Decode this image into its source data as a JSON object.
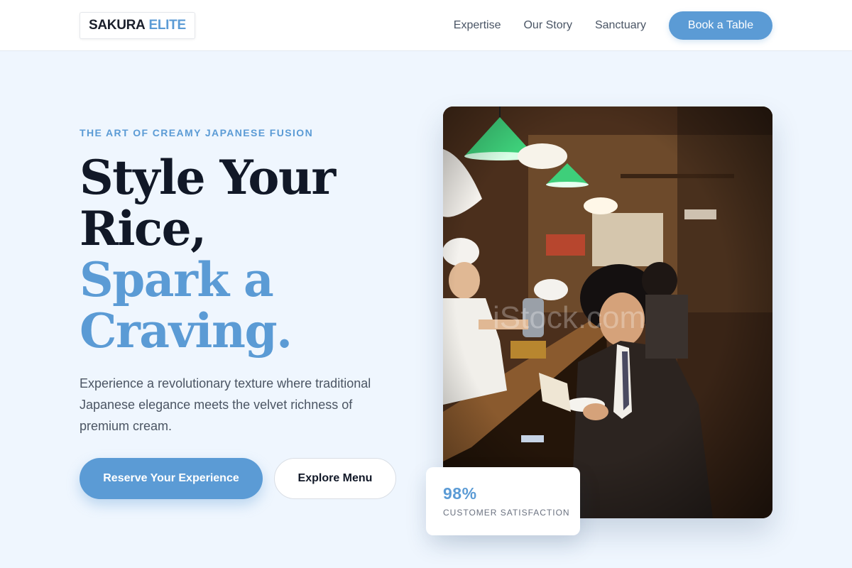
{
  "header": {
    "brand_part1": "SAKURA",
    "brand_part2": "ELITE",
    "nav": [
      "Expertise",
      "Our Story",
      "Sanctuary"
    ],
    "cta": "Book a Table"
  },
  "hero": {
    "eyebrow": "THE ART OF CREAMY JAPANESE FUSION",
    "title_line1": "Style Your",
    "title_line2": "Rice,",
    "title_line3": "Spark a",
    "title_line4": "Craving.",
    "description": "Experience a revolutionary texture where traditional Japanese elegance meets the velvet richness of premium cream.",
    "primary_button": "Reserve Your Experience",
    "secondary_button": "Explore Menu"
  },
  "stat": {
    "value": "98%",
    "label": "CUSTOMER SATISFACTION"
  },
  "colors": {
    "accent": "#5b9bd5",
    "background": "#eff6fe",
    "heading": "#111827"
  },
  "image": {
    "watermark": "iStock.com"
  }
}
